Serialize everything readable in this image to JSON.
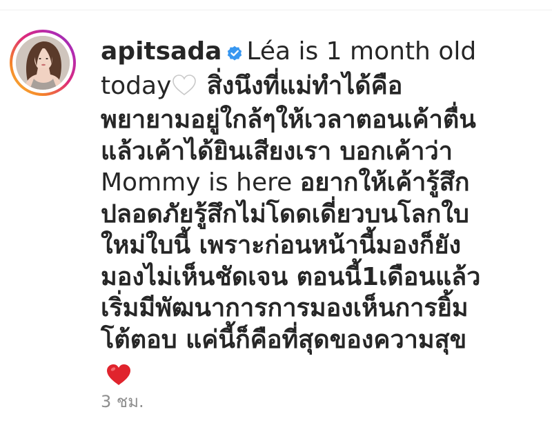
{
  "comment": {
    "username": "apitsada",
    "verified": true,
    "seg_latin_1": "Léa is 1 month old",
    "seg_latin_2": "today",
    "heart_outline": "white-heart-emoji",
    "lines": [
      "สิ่งนึงที่แม่ทำได้คือ",
      "พยายามอยู่ใกล้ๆให้เวลาตอนเค้าตื่น",
      "แล้วเค้าได้ยินเสียงเรา บอกเค้าว่า",
      "Mommy is here",
      "อยากให้เค้ารู้สึก",
      "ปลอดภัยรู้สึกไม่โดดเดี่ยวบนโลกใบ",
      "ใหม่ใบนี้ เพราะก่อนหน้านี้มองก็ยัง",
      "มองไม่เห็นชัดเจน ตอนนี้1เดือนแล้ว",
      "เริ่มมีพัฒนาการการมองเห็นการยิ้ม",
      "โต้ตอบ แค่นี้ก็คือที่สุดของความสุข"
    ],
    "end_emoji": "red-heart-emoji",
    "timestamp": "3 ชม."
  },
  "colors": {
    "text": "#262626",
    "muted": "#8e8e8e",
    "verified_blue": "#3897f0",
    "heart_red": "#e0242d",
    "divider": "#efefef"
  },
  "icons": {
    "verified": "verified-badge-icon",
    "heart_outline": "white-heart-icon",
    "heart_red": "red-heart-icon"
  }
}
